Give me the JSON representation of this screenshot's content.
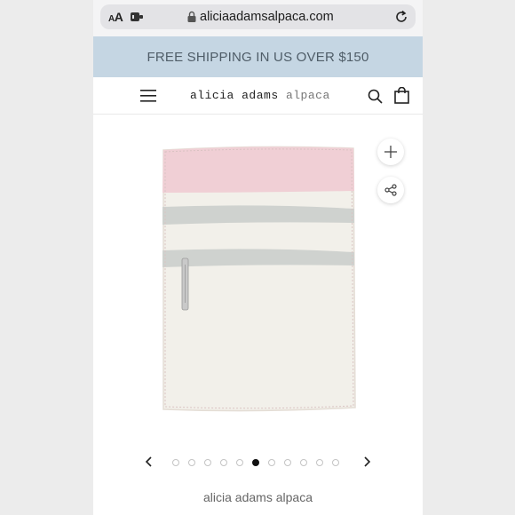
{
  "browser": {
    "aa_label_big": "A",
    "aa_label_small": "A",
    "url": "aliciaadamsalpaca.com"
  },
  "promo": {
    "text": "FREE SHIPPING IN US OVER $150"
  },
  "header": {
    "brand_part1": "alicia adams",
    "brand_part2": "alpaca"
  },
  "product": {
    "image_icon": "blanket-image",
    "colors": {
      "pink": "#f0cfd5",
      "grey_stripe": "#cfd2cf",
      "body": "#f2f0ea"
    }
  },
  "carousel": {
    "dot_count": 11,
    "active_index": 5
  },
  "caption": {
    "text": "alicia adams alpaca"
  }
}
